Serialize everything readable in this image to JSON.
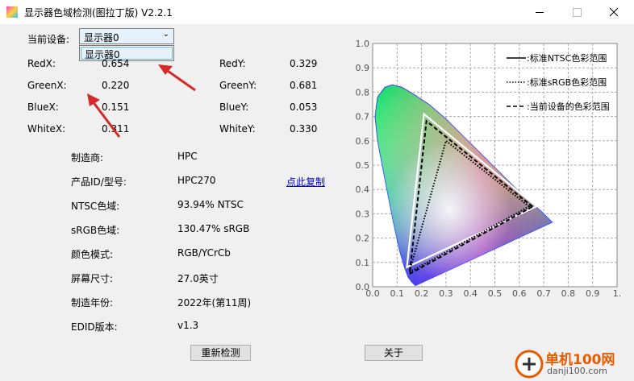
{
  "window": {
    "title": "显示器色域检测(图拉丁版) V2.2.1"
  },
  "device": {
    "label": "当前设备:",
    "selected": "显示器0",
    "options": [
      "显示器0"
    ]
  },
  "coords": [
    {
      "label": "RedX:",
      "value": "0.654"
    },
    {
      "label": "RedY:",
      "value": "0.329"
    },
    {
      "label": "GreenX:",
      "value": "0.220"
    },
    {
      "label": "GreenY:",
      "value": "0.681"
    },
    {
      "label": "BlueX:",
      "value": "0.151"
    },
    {
      "label": "BlueY:",
      "value": "0.053"
    },
    {
      "label": "WhiteX:",
      "value": "0.311"
    },
    {
      "label": "WhiteY:",
      "value": "0.330"
    }
  ],
  "info": [
    {
      "label": "制造商:",
      "value": "HPC"
    },
    {
      "label": "产品ID/型号:",
      "value": "HPC270"
    },
    {
      "label": "NTSC色域:",
      "value": "93.94% NTSC"
    },
    {
      "label": "sRGB色域:",
      "value": "130.47% sRGB"
    },
    {
      "label": "颜色模式:",
      "value": "RGB/YCrCb"
    },
    {
      "label": "屏幕尺寸:",
      "value": "27.0英寸"
    },
    {
      "label": "制造年份:",
      "value": "2022年(第11周)"
    },
    {
      "label": "EDID版本:",
      "value": "v1.3"
    }
  ],
  "copy_link": "点此复制",
  "buttons": {
    "redetect": "重新检测",
    "about": "关于"
  },
  "watermark": {
    "line1": "单机100网",
    "line2": "danji100.com"
  },
  "chart_data": {
    "type": "scatter",
    "title": "",
    "xlabel": "",
    "ylabel": "",
    "xlim": [
      0,
      1.0
    ],
    "ylim": [
      0,
      1.0
    ],
    "x_ticks": [
      "0.0",
      "0.1",
      "0.2",
      "0.3",
      "0.4",
      "0.5",
      "0.6",
      "0.7",
      "0.8",
      "0.9",
      "1."
    ],
    "y_ticks": [
      "0.0",
      "0.1",
      "0.2",
      "0.3",
      "0.4",
      "0.5",
      "0.6",
      "0.7",
      "0.8",
      "0.9",
      "1.0"
    ],
    "grid": true,
    "legend_position": "top-right",
    "series": [
      {
        "name": "标准NTSC色彩范围",
        "style": "solid",
        "color": "#ffffff",
        "points": [
          [
            0.67,
            0.33
          ],
          [
            0.21,
            0.71
          ],
          [
            0.14,
            0.08
          ]
        ]
      },
      {
        "name": "标准sRGB色彩范围",
        "style": "dotted",
        "color": "#000000",
        "points": [
          [
            0.64,
            0.33
          ],
          [
            0.3,
            0.6
          ],
          [
            0.15,
            0.06
          ]
        ]
      },
      {
        "name": "当前设备的色彩范围",
        "style": "dashed",
        "color": "#000000",
        "points": [
          [
            0.654,
            0.329
          ],
          [
            0.22,
            0.681
          ],
          [
            0.151,
            0.053
          ]
        ]
      }
    ],
    "locus": [
      [
        0.175,
        0.005
      ],
      [
        0.17,
        0.01
      ],
      [
        0.16,
        0.02
      ],
      [
        0.145,
        0.04
      ],
      [
        0.13,
        0.08
      ],
      [
        0.11,
        0.15
      ],
      [
        0.09,
        0.24
      ],
      [
        0.07,
        0.34
      ],
      [
        0.045,
        0.47
      ],
      [
        0.02,
        0.6
      ],
      [
        0.01,
        0.7
      ],
      [
        0.02,
        0.78
      ],
      [
        0.05,
        0.82
      ],
      [
        0.08,
        0.83
      ],
      [
        0.12,
        0.82
      ],
      [
        0.17,
        0.79
      ],
      [
        0.23,
        0.75
      ],
      [
        0.3,
        0.69
      ],
      [
        0.37,
        0.62
      ],
      [
        0.44,
        0.55
      ],
      [
        0.51,
        0.48
      ],
      [
        0.58,
        0.41
      ],
      [
        0.65,
        0.345
      ],
      [
        0.69,
        0.31
      ],
      [
        0.735,
        0.265
      ]
    ]
  }
}
